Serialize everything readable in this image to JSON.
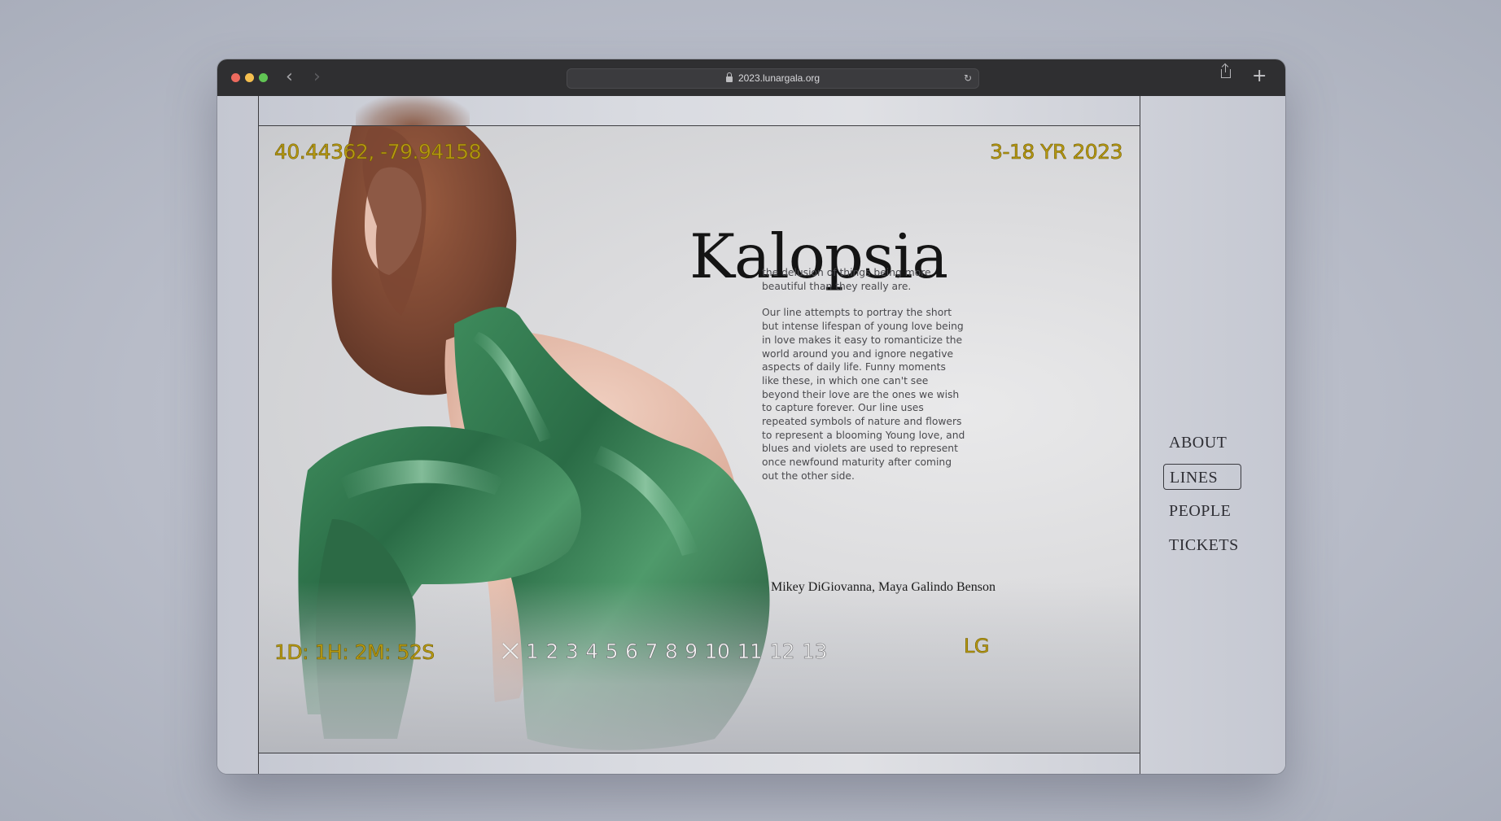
{
  "browser": {
    "url": "2023.lunargala.org"
  },
  "hud": {
    "coordinates": "40.44362, -79.94158",
    "date_range": "3-18 YR 2023",
    "countdown": "1D: 1H: 2M: 52S",
    "logo": "LG"
  },
  "line": {
    "title": "Kalopsia",
    "definition": "the delusion of things being more beautiful than they really are.",
    "description": "Our line attempts to portray the short but intense lifespan of young love being in love makes it easy to romanticize the world around you and ignore negative aspects of daily life. Funny moments like these, in which one can't see beyond their love are the ones we wish to capture forever. Our line uses repeated symbols of nature and flowers to represent a blooming Young love, and blues and violets are used to represent once newfound maturity after coming out the other side.",
    "designers": "Mikey DiGiovanna, Maya Galindo Benson"
  },
  "pager": {
    "pages": [
      "1",
      "2",
      "3",
      "4",
      "5",
      "6",
      "7",
      "8",
      "9",
      "10",
      "11",
      "12",
      "13"
    ]
  },
  "menu": {
    "about": "ABOUT",
    "lines": "LINES",
    "people": "PEOPLE",
    "tickets": "TICKETS",
    "active": "LINES"
  },
  "icons": {
    "close": "close-icon",
    "back": "back-arrow-icon",
    "forward": "forward-arrow-icon",
    "lock": "lock-icon",
    "reload": "reload-icon",
    "share": "share-icon",
    "new_tab": "plus-icon",
    "cursor": "mouse-pointer-icon"
  },
  "colors": {
    "hud_text": "#b89a12",
    "pager_text": "#f4f4f4",
    "dress_green": "#2f6a45"
  }
}
